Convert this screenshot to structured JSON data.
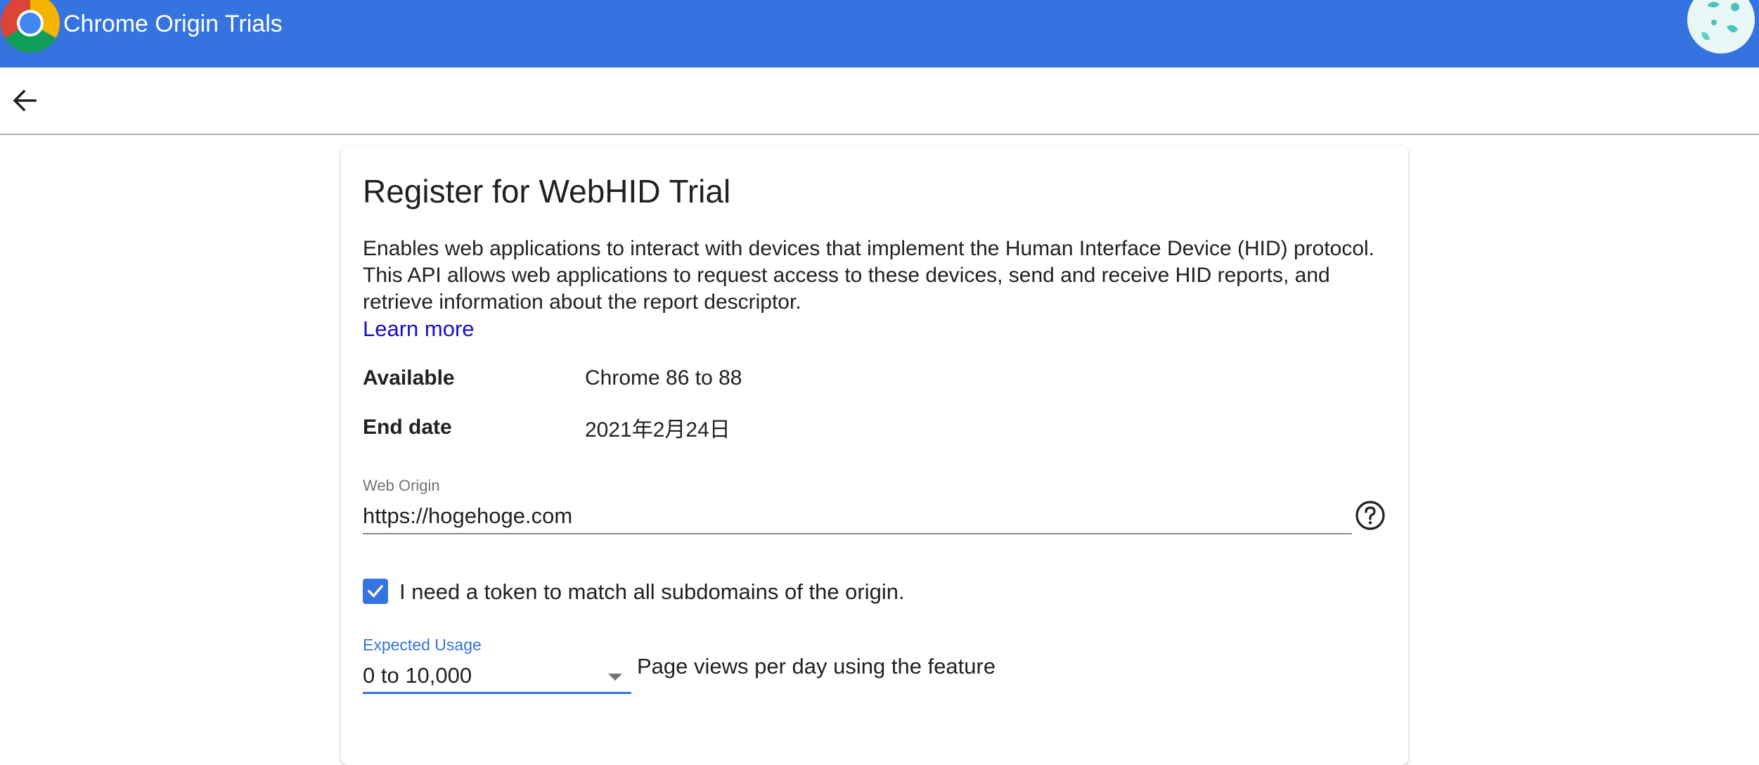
{
  "app_bar": {
    "title": "Chrome Origin Trials",
    "logo_icon": "chrome-logo-icon",
    "avatar_icon": "avatar-icon",
    "background_color": "#3574e0"
  },
  "toolbar": {
    "back_icon": "arrow-back-icon"
  },
  "card": {
    "title": "Register for WebHID Trial",
    "description": "Enables web applications to interact with devices that implement the Human Interface Device (HID) protocol. This API allows web applications to request access to these devices, send and receive HID reports, and retrieve information about the report descriptor.",
    "learn_more": "Learn more",
    "available_label": "Available",
    "available_value": "Chrome 86 to 88",
    "end_date_label": "End date",
    "end_date_value": "2021年2月24日",
    "web_origin": {
      "label": "Web Origin",
      "value": "https://hogehoge.com",
      "help_icon": "help-circle-icon"
    },
    "subdomain_checkbox": {
      "checked": true,
      "label": "I need a token to match all subdomains of the origin."
    },
    "expected_usage": {
      "label": "Expected Usage",
      "selected": "0 to 10,000",
      "suffix": "Page views per day using the feature"
    }
  },
  "colors": {
    "accent": "#3574e0",
    "link": "#1a0dcc",
    "text": "#202124",
    "muted": "#70757a"
  }
}
